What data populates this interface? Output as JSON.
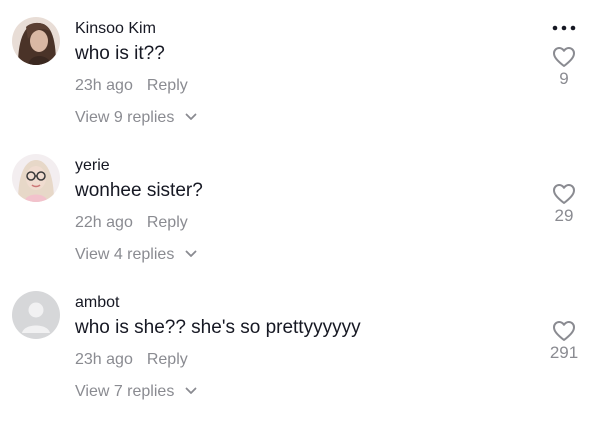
{
  "colors": {
    "text": "#161823",
    "secondary": "#8a8b91",
    "background": "#ffffff"
  },
  "icons": {
    "like": "heart-outline-icon",
    "more": "more-horizontal-icon",
    "expand": "chevron-down-icon"
  },
  "comments": [
    {
      "username": "Kinsoo Kim",
      "text": "who is it??",
      "time": "23h ago",
      "reply_label": "Reply",
      "view_replies": "View 9 replies",
      "likes": "9"
    },
    {
      "username": "yerie",
      "text": "wonhee sister?",
      "time": "22h ago",
      "reply_label": "Reply",
      "view_replies": "View 4 replies",
      "likes": "29"
    },
    {
      "username": "ambot",
      "text": "who is she?? she's so prettyyyyyy",
      "time": "23h ago",
      "reply_label": "Reply",
      "view_replies": "View 7 replies",
      "likes": "291"
    }
  ]
}
